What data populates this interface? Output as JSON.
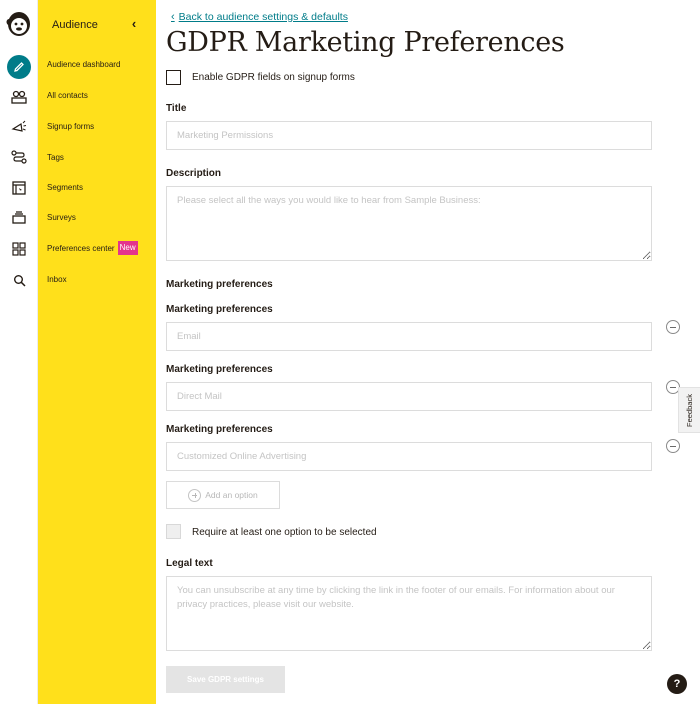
{
  "nav": {
    "title": "Audience",
    "collapse_icon": "chevron-left-icon",
    "items": [
      {
        "label": "Audience dashboard"
      },
      {
        "label": "All contacts"
      },
      {
        "label": "Signup forms"
      },
      {
        "label": "Tags"
      },
      {
        "label": "Segments"
      },
      {
        "label": "Surveys"
      },
      {
        "label": "Preferences center",
        "badge": "New"
      },
      {
        "label": "Inbox"
      }
    ]
  },
  "rail": {
    "icons": [
      "mailchimp-logo-icon",
      "pencil-icon",
      "audience-icon",
      "campaign-megaphone-icon",
      "automations-icon",
      "website-icon",
      "content-icon",
      "integrations-grid-icon",
      "search-icon"
    ]
  },
  "main": {
    "back_link": "Back to audience settings & defaults",
    "title": "GDPR Marketing Preferences",
    "enable_label": "Enable GDPR fields on signup forms",
    "title_label": "Title",
    "title_placeholder": "Marketing Permissions",
    "description_label": "Description",
    "description_placeholder": "Please select all the ways you would like to hear from Sample Business:",
    "preferences_heading": "Marketing preferences",
    "options": [
      {
        "label": "Marketing preferences",
        "placeholder": "Email"
      },
      {
        "label": "Marketing preferences",
        "placeholder": "Direct Mail"
      },
      {
        "label": "Marketing preferences",
        "placeholder": "Customized Online Advertising"
      }
    ],
    "add_option": "Add an option",
    "require_label": "Require at least one option to be selected",
    "legal_label": "Legal text",
    "legal_placeholder": "You can unsubscribe at any time by clicking the link in the footer of our emails. For information about our privacy practices, please visit our website.",
    "save_label": "Save GDPR settings"
  },
  "feedback": "Feedback",
  "help": "?",
  "colors": {
    "brand_yellow": "#ffe01b",
    "accent_teal": "#007c89",
    "badge_pink": "#e3348d",
    "text_dark": "#241c15"
  }
}
